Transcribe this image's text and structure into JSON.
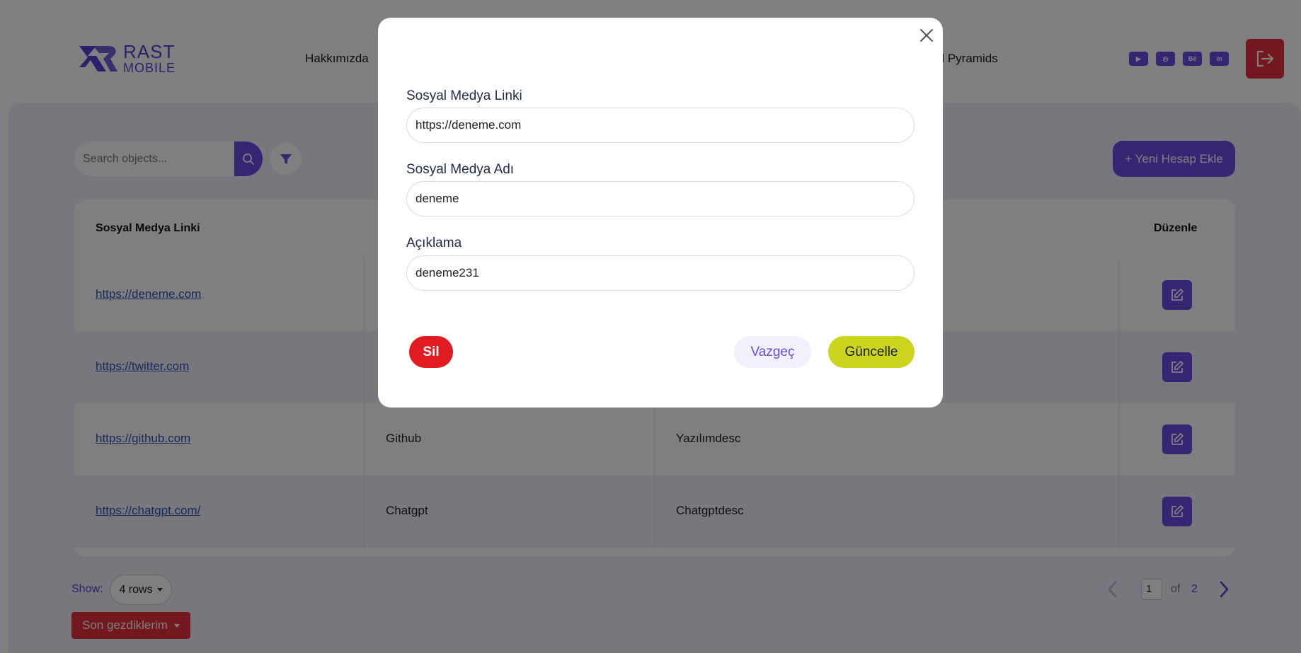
{
  "header": {
    "logo": {
      "line1": "RAST",
      "line2": "MOBILE"
    },
    "nav": [
      "Hakkımızda",
      "rd Pyramids"
    ],
    "socials": [
      {
        "icon": "youtube-icon",
        "glyph": "▶"
      },
      {
        "icon": "instagram-icon",
        "glyph": "◎"
      },
      {
        "icon": "behance-icon",
        "glyph": "Bē"
      },
      {
        "icon": "linkedin-icon",
        "glyph": "in"
      }
    ]
  },
  "toolbar": {
    "search_placeholder": "Search objects...",
    "new_button_label": "+ Yeni Hesap Ekle"
  },
  "table": {
    "headers": {
      "link": "Sosyal Medya Linki",
      "edit": "Düzenle"
    },
    "rows": [
      {
        "link": "https://deneme.com",
        "name": "",
        "desc": ""
      },
      {
        "link": "https://twitter.com",
        "name": "",
        "desc": ""
      },
      {
        "link": "https://github.com",
        "name": "Github",
        "desc": "Yazılımdesc"
      },
      {
        "link": "https://chatgpt.com/",
        "name": "Chatgpt",
        "desc": "Chatgptdesc"
      }
    ]
  },
  "footer": {
    "show_label": "Show:",
    "rows_value": "4 rows",
    "recent_label": "Son gezdiklerim",
    "page_current": "1",
    "page_of": "of",
    "page_total": "2"
  },
  "modal": {
    "fields": [
      {
        "label": "Sosyal Medya Linki",
        "value": "https://deneme.com"
      },
      {
        "label": "Sosyal Medya Adı",
        "value": "deneme"
      },
      {
        "label": "Açıklama",
        "value": "deneme231"
      }
    ],
    "delete_label": "Sil",
    "cancel_label": "Vazgeç",
    "update_label": "Güncelle"
  },
  "colors": {
    "brand_purple": "#6a4be6",
    "danger_red": "#e21a21",
    "update_lime": "#cbd51f",
    "panel_bg": "#edf0fb"
  }
}
